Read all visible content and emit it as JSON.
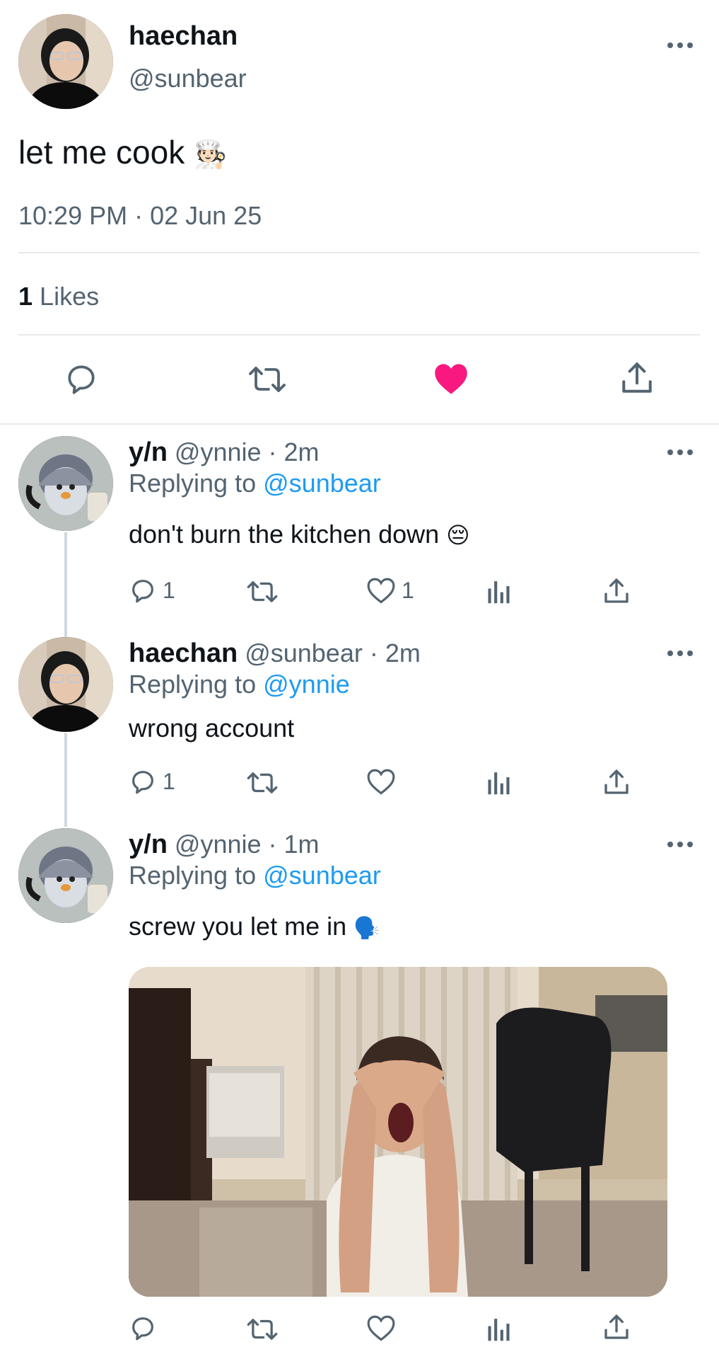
{
  "main_tweet": {
    "display_name": "haechan",
    "handle": "@sunbear",
    "text": "let me cook",
    "emoji": "🧑🏻‍🍳",
    "timestamp": "10:29 PM · 02 Jun 25",
    "likes_count": "1",
    "likes_label": "Likes",
    "liked": true
  },
  "replies": [
    {
      "display_name": "y/n",
      "meta": "@ynnie · 2m",
      "replying_prefix": "Replying to",
      "replying_to": "@sunbear",
      "text": "don't burn the kitchen down",
      "emoji": "😔",
      "reply_count": "1",
      "like_count": "1"
    },
    {
      "display_name": "haechan",
      "meta": "@sunbear · 2m",
      "replying_prefix": "Replying to",
      "replying_to": "@ynnie",
      "text": "wrong account",
      "reply_count": "1",
      "like_count": ""
    },
    {
      "display_name": "y/n",
      "meta": "@ynnie · 1m",
      "replying_prefix": "Replying to",
      "replying_to": "@sunbear",
      "text": "screw you let me in",
      "emoji": "🗣️",
      "has_media": true
    }
  ],
  "colors": {
    "accent": "#1d9bf0",
    "like": "#f91880",
    "muted": "#536471",
    "divider": "#e7e9ec"
  },
  "icons": [
    "reply-icon",
    "retweet-icon",
    "heart-icon",
    "share-icon",
    "views-icon",
    "more-icon"
  ]
}
